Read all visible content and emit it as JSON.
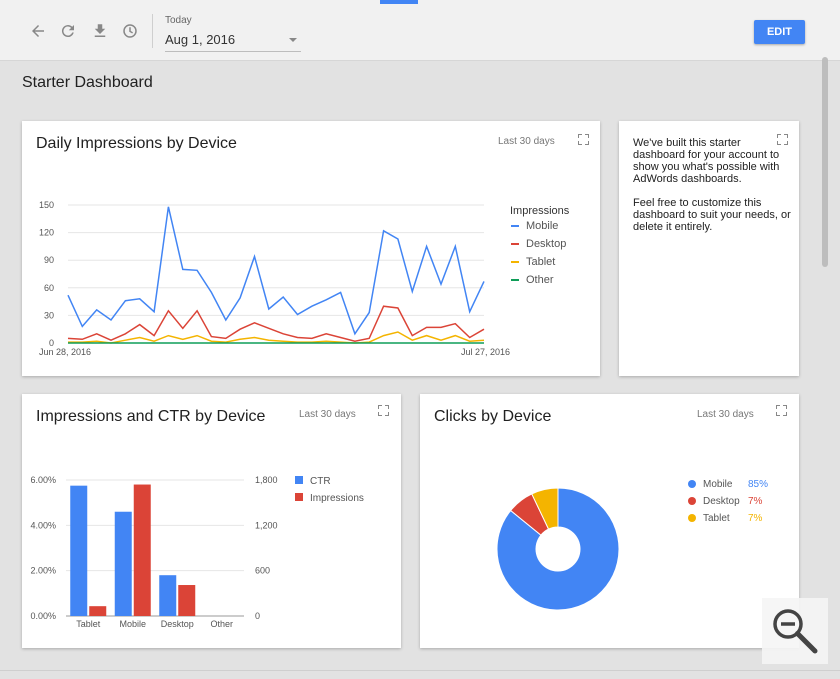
{
  "toolbar": {
    "icons": [
      "back-arrow-icon",
      "refresh-icon",
      "download-icon",
      "history-clock-icon"
    ],
    "date_label": "Today",
    "date_value": "Aug 1, 2016",
    "edit_label": "EDIT",
    "accent_color": "#4285f4"
  },
  "page_title": "Starter Dashboard",
  "cards": {
    "daily": {
      "title": "Daily Impressions by Device",
      "range": "Last 30 days"
    },
    "note": {
      "paragraph1": "We've built this starter dashboard for your account to show you what's possible with AdWords dashboards.",
      "paragraph2": "Feel free to customize this dashboard to suit your needs, or delete it entirely."
    },
    "ctr": {
      "title": "Impressions and CTR by Device",
      "range": "Last 30 days"
    },
    "clicks": {
      "title": "Clicks by Device",
      "range": "Last 30 days"
    }
  },
  "chart_data": [
    {
      "type": "line",
      "title": "Daily Impressions by Device",
      "x_start_label": "Jun 28, 2016",
      "x_end_label": "Jul 27, 2016",
      "ylim": [
        0,
        150
      ],
      "y_ticks": [
        0,
        30,
        60,
        90,
        120,
        150
      ],
      "legend_title": "Impressions",
      "legend_position": "right",
      "series": [
        {
          "name": "Mobile",
          "color": "#4285f4",
          "values": [
            52,
            18,
            36,
            25,
            46,
            48,
            34,
            148,
            80,
            79,
            55,
            25,
            49,
            94,
            37,
            50,
            31,
            40,
            47,
            55,
            10,
            33,
            122,
            113,
            56,
            105,
            64,
            105,
            34,
            67
          ]
        },
        {
          "name": "Desktop",
          "color": "#db4437",
          "values": [
            5,
            4,
            10,
            3,
            10,
            20,
            8,
            35,
            16,
            35,
            7,
            5,
            15,
            22,
            16,
            10,
            6,
            5,
            10,
            6,
            2,
            5,
            40,
            38,
            8,
            17,
            17,
            21,
            6,
            15
          ]
        },
        {
          "name": "Tablet",
          "color": "#f4b400",
          "values": [
            1,
            1,
            2,
            0,
            3,
            6,
            2,
            8,
            4,
            8,
            2,
            1,
            4,
            6,
            3,
            2,
            1,
            1,
            2,
            1,
            0,
            1,
            8,
            12,
            3,
            8,
            3,
            8,
            2,
            3
          ]
        },
        {
          "name": "Other",
          "color": "#0f9d58",
          "values": [
            0,
            0,
            0,
            0,
            0,
            0,
            0,
            0,
            0,
            0,
            0,
            0,
            0,
            0,
            0,
            0,
            0,
            0,
            0,
            0,
            0,
            0,
            0,
            0,
            0,
            0,
            0,
            0,
            0,
            0
          ]
        }
      ]
    },
    {
      "type": "bar",
      "title": "Impressions and CTR by Device",
      "categories": [
        "Tablet",
        "Mobile",
        "Desktop",
        "Other"
      ],
      "left_axis": {
        "ylim": [
          0,
          6
        ],
        "ticks": [
          "0.00%",
          "2.00%",
          "4.00%",
          "6.00%"
        ]
      },
      "right_axis": {
        "ylim": [
          0,
          1800
        ],
        "ticks": [
          "0",
          "600",
          "1,200",
          "1,800"
        ]
      },
      "legend_position": "right",
      "series": [
        {
          "name": "CTR",
          "color": "#4285f4",
          "axis": "left",
          "values": [
            5.75,
            4.6,
            1.8,
            0
          ]
        },
        {
          "name": "Impressions",
          "color": "#db4437",
          "axis": "right",
          "values": [
            130,
            1740,
            410,
            0
          ]
        }
      ]
    },
    {
      "type": "pie",
      "title": "Clicks by Device",
      "legend_position": "right",
      "slices": [
        {
          "name": "Mobile",
          "pct_label": "85%",
          "value": 85,
          "color": "#4285f4"
        },
        {
          "name": "Desktop",
          "pct_label": "7%",
          "value": 7,
          "color": "#db4437"
        },
        {
          "name": "Tablet",
          "pct_label": "7%",
          "value": 7,
          "color": "#f4b400"
        }
      ]
    }
  ],
  "zoom_icon": "zoom-out-icon"
}
